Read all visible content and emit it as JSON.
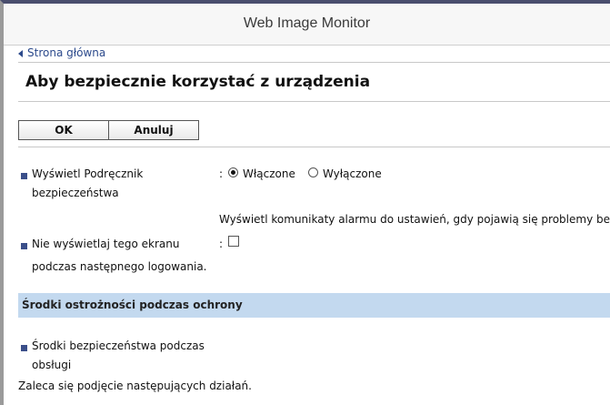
{
  "header": {
    "title": "Web Image Monitor"
  },
  "breadcrumb": {
    "label": "Strona główna"
  },
  "page": {
    "heading": "Aby bezpiecznie korzystać z urządzenia"
  },
  "actions": {
    "ok_label": "OK",
    "cancel_label": "Anuluj"
  },
  "settings": {
    "guide": {
      "label_line1": "Wyświetl Podręcznik",
      "label_line2": "bezpieczeństwa",
      "colon": ":",
      "option_on": "Włączone",
      "option_off": "Wyłączone",
      "selected": "Włączone",
      "description": "Wyświetl komunikaty alarmu do ustawień, gdy pojawią się problemy be"
    },
    "hide_screen": {
      "label_line1": "Nie wyświetlaj tego ekranu",
      "label_line2": "podczas następnego logowania.",
      "colon": ":",
      "checked": false
    }
  },
  "section": {
    "title": "Środki ostrożności podczas ochrony",
    "item": {
      "label_line1": "Środki bezpieczeństwa podczas",
      "label_line2": "obsługi"
    },
    "note": "Zaleca się podjęcie następujących działań."
  },
  "colors": {
    "accent_blue": "#3b4f8a",
    "section_bar": "#c3d9ef",
    "link": "#2c4a8c"
  }
}
